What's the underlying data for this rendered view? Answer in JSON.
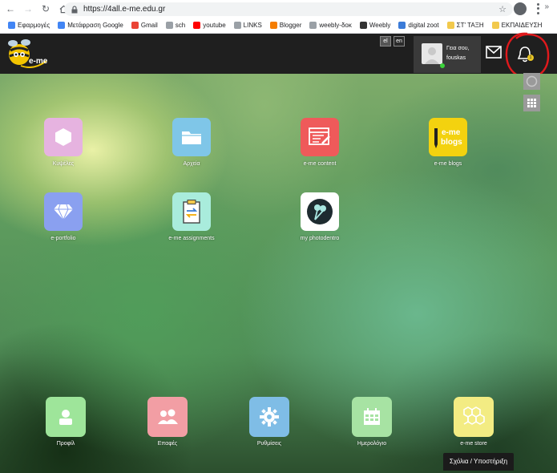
{
  "browser": {
    "url": "https://4all.e-me.edu.gr",
    "bookmarks": [
      {
        "label": "Εφαρμογές",
        "icon": "apps-grid-icon",
        "color": "#4285f4"
      },
      {
        "label": "Μετάφραση Google",
        "icon": "translate-icon",
        "color": "#4285f4"
      },
      {
        "label": "Gmail",
        "icon": "google-icon",
        "color": "#ea4335"
      },
      {
        "label": "sch",
        "icon": "page-icon",
        "color": "#9aa0a6"
      },
      {
        "label": "youtube",
        "icon": "youtube-icon",
        "color": "#ff0000"
      },
      {
        "label": "LINKS",
        "icon": "page-icon",
        "color": "#9aa0a6"
      },
      {
        "label": "Blogger",
        "icon": "blogger-icon",
        "color": "#f57d00"
      },
      {
        "label": "weebly-δοκ",
        "icon": "page-icon",
        "color": "#9aa0a6"
      },
      {
        "label": "Weebly",
        "icon": "weebly-icon",
        "color": "#333333"
      },
      {
        "label": "digital zoot",
        "icon": "wix-icon",
        "color": "#3b7bd8"
      },
      {
        "label": "ΣΤ' ΤΑΞΗ",
        "icon": "folder-icon",
        "color": "#f2c94c"
      },
      {
        "label": "ΕΚΠΑΙΔΕΥΣΗ",
        "icon": "folder-icon",
        "color": "#f2c94c"
      }
    ],
    "more": "»"
  },
  "header": {
    "lang_el": "el",
    "lang_en": "en",
    "greeting": "Γεια σου,",
    "username": "fouskas",
    "notification_count": "1",
    "logo_text": "e-me"
  },
  "apps": [
    {
      "label": "Κυψέλες",
      "icon": "hexagon-icon",
      "color": "#e6b3e0"
    },
    {
      "label": "Αρχεία",
      "icon": "folder-icon",
      "color": "#7fc6e8"
    },
    {
      "label": "e-me content",
      "icon": "content-editor-icon",
      "color": "#ef5a5a"
    },
    {
      "label": "e-me blogs",
      "icon": "blogs-icon",
      "color": "#f3d20f",
      "icon_text": "e-me blogs"
    },
    {
      "label": "e-portfolio",
      "icon": "diamond-icon",
      "color": "#8aa0f0"
    },
    {
      "label": "e-me assignments",
      "icon": "clipboard-icon",
      "color": "#a9ecdc"
    },
    {
      "label": "my photodentro",
      "icon": "photodentro-icon",
      "color": "#ffffff"
    }
  ],
  "dock": [
    {
      "label": "Προφίλ",
      "icon": "user-icon",
      "color": "#9ee59a"
    },
    {
      "label": "Επαφές",
      "icon": "contacts-icon",
      "color": "#f29ea4"
    },
    {
      "label": "Ρυθμίσεις",
      "icon": "gear-icon",
      "color": "#7fbde6"
    },
    {
      "label": "Ημερολόγιο",
      "icon": "calendar-icon",
      "color": "#a7e3a3"
    },
    {
      "label": "e-me store",
      "icon": "honeycomb-icon",
      "color": "#f3ec83"
    }
  ],
  "support": "Σχόλια / Υποστήριξη"
}
